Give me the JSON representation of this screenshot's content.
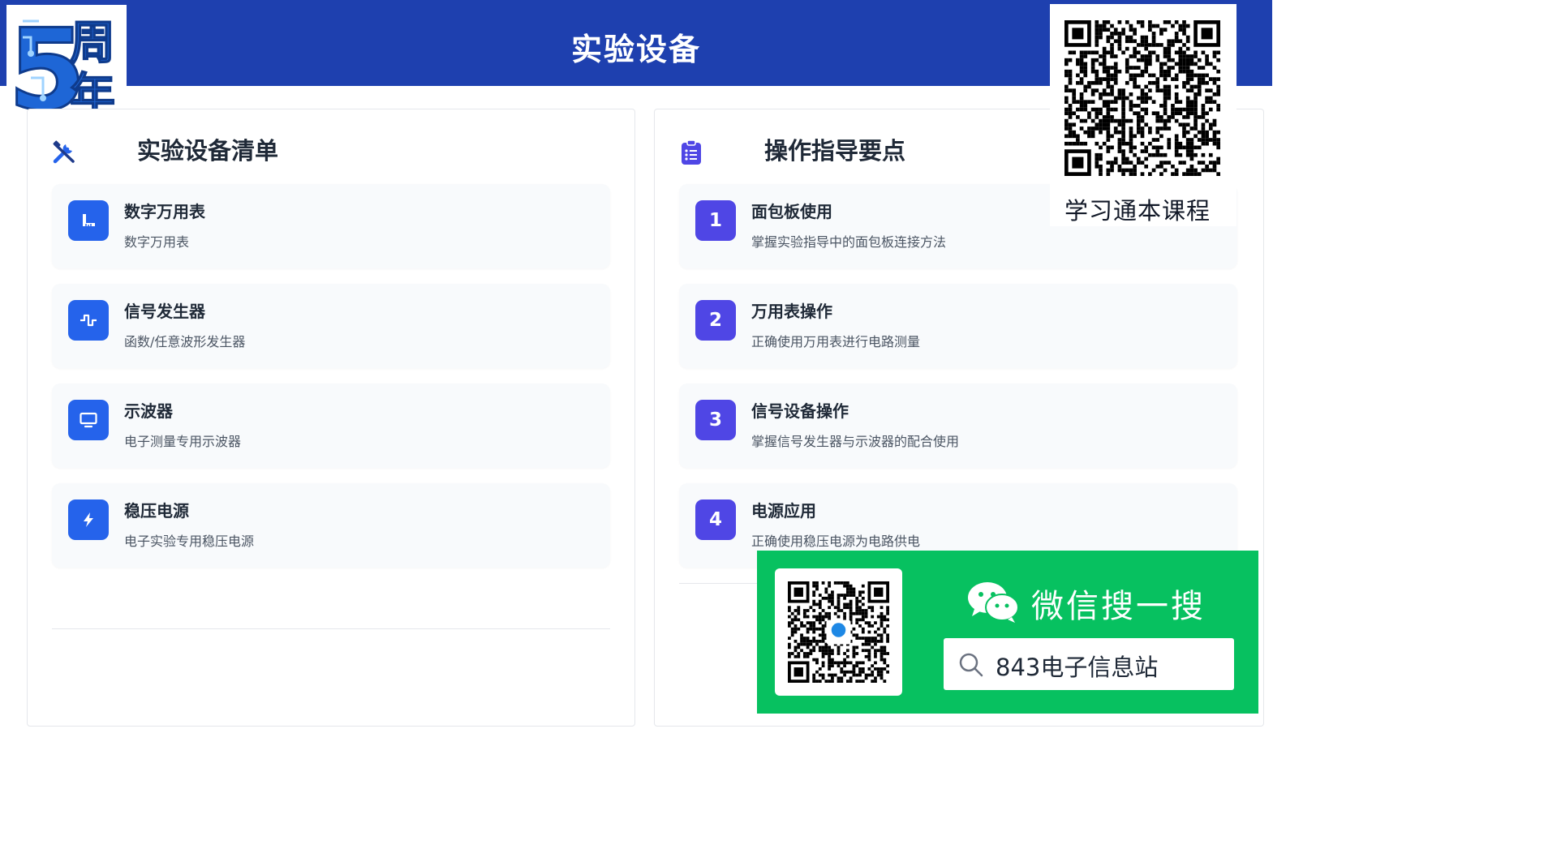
{
  "header": {
    "title": "实验设备"
  },
  "logo": {
    "digit": "5",
    "text": "周年",
    "icon": "anniversary-logo-icon"
  },
  "equipment_panel": {
    "title": "实验设备清单",
    "icon": "tools-icon",
    "items": [
      {
        "name": "数字万用表",
        "desc": "数字万用表",
        "icon": "ruler-icon"
      },
      {
        "name": "信号发生器",
        "desc": "函数/任意波形发生器",
        "icon": "wave-icon"
      },
      {
        "name": "示波器",
        "desc": "电子测量专用示波器",
        "icon": "monitor-icon"
      },
      {
        "name": "稳压电源",
        "desc": "电子实验专用稳压电源",
        "icon": "bolt-icon"
      }
    ]
  },
  "guide_panel": {
    "title": "操作指导要点",
    "icon": "clipboard-list-icon",
    "items": [
      {
        "num": "1",
        "name": "面包板使用",
        "desc": "掌握实验指导中的面包板连接方法"
      },
      {
        "num": "2",
        "name": "万用表操作",
        "desc": "正确使用万用表进行电路测量"
      },
      {
        "num": "3",
        "name": "信号设备操作",
        "desc": "掌握信号发生器与示波器的配合使用"
      },
      {
        "num": "4",
        "name": "电源应用",
        "desc": "正确使用稳压电源为电路供电"
      }
    ]
  },
  "qr_overlay": {
    "caption": "学习通本课程",
    "icon": "qr-code-icon"
  },
  "wechat": {
    "title": "微信搜一搜",
    "search_text": "843电子信息站",
    "icon": "wechat-icon",
    "search_icon": "search-icon"
  },
  "colors": {
    "banner": "#1e40af",
    "equipment_icon_bg": "#2563eb",
    "guide_number_bg": "#4f46e5",
    "wechat_green": "#07c160"
  }
}
